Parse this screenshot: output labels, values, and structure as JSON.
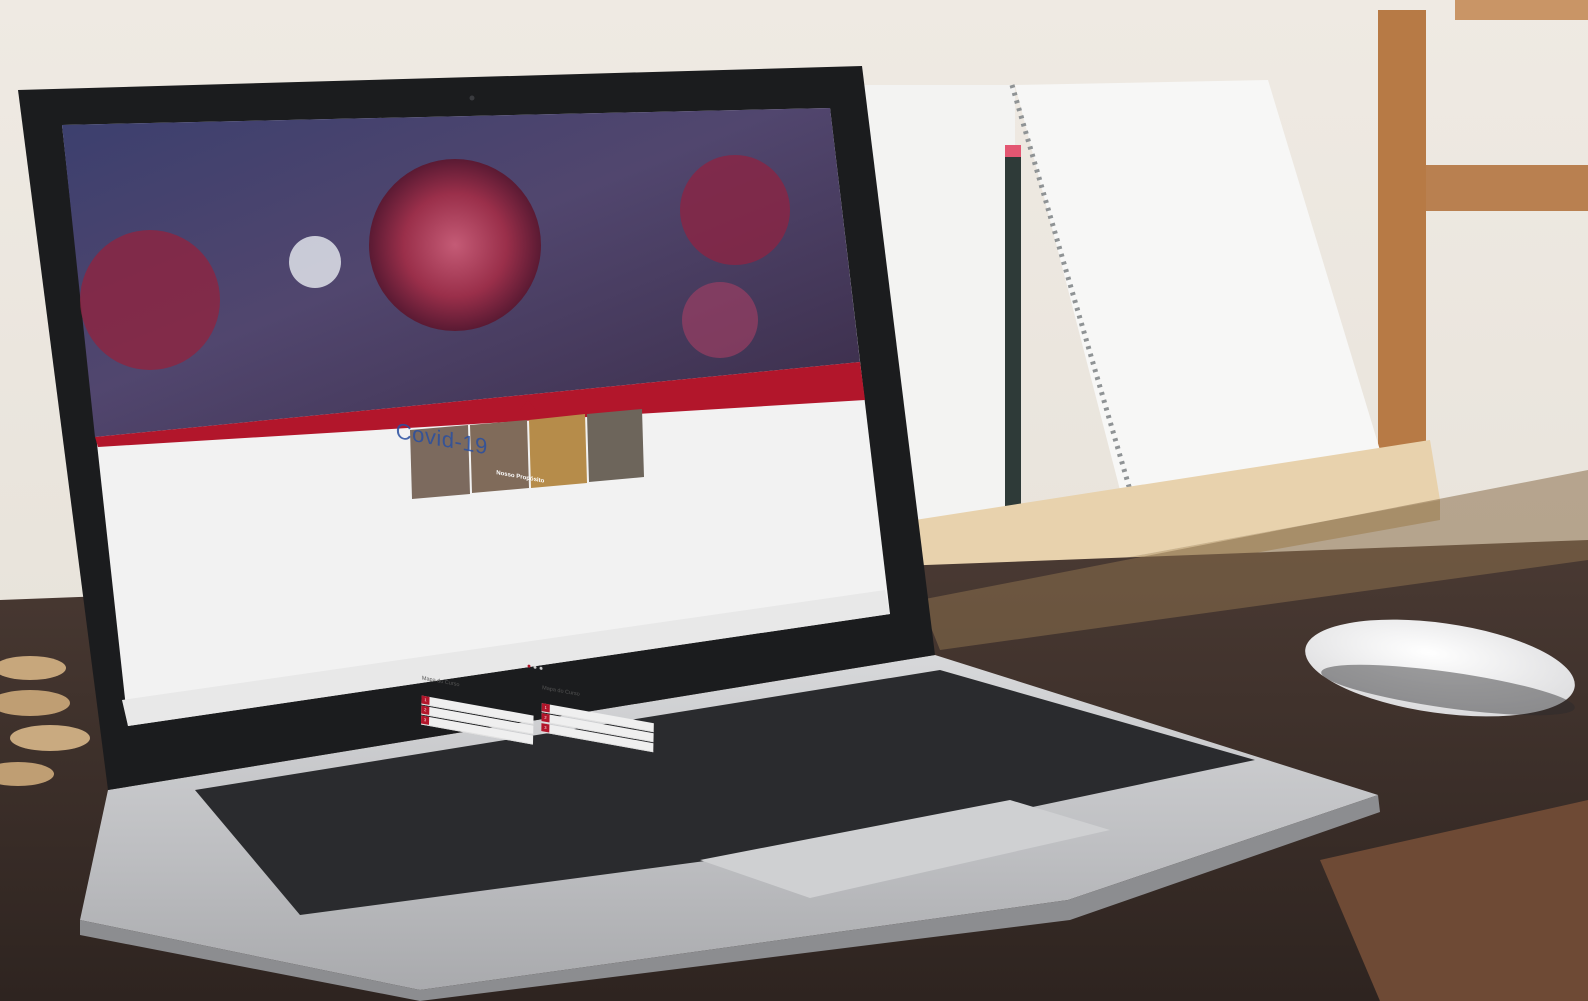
{
  "screen": {
    "hero_title": "Covid-19",
    "band_title": "Nosso Propósito",
    "cards": [
      {
        "name": "",
        "text": ""
      },
      {
        "name": "",
        "text": ""
      },
      {
        "name": "",
        "text": ""
      },
      {
        "name": "",
        "text": ""
      }
    ],
    "carousel_dots": 3,
    "carousel_active": 0,
    "map_left": {
      "title": "Mapa do Curso",
      "subtitle": "",
      "rows": [
        "",
        "",
        ""
      ]
    },
    "map_right": {
      "title": "Mapa do Curso",
      "subtitle": "",
      "rows": [
        "",
        "",
        ""
      ]
    }
  },
  "colors": {
    "accent_red": "#b2162b",
    "hero_blue": "#2a4fa0",
    "wall": "#ebe6df",
    "desk": "#3b2e29",
    "laptop_silver": "#c9cacc"
  }
}
